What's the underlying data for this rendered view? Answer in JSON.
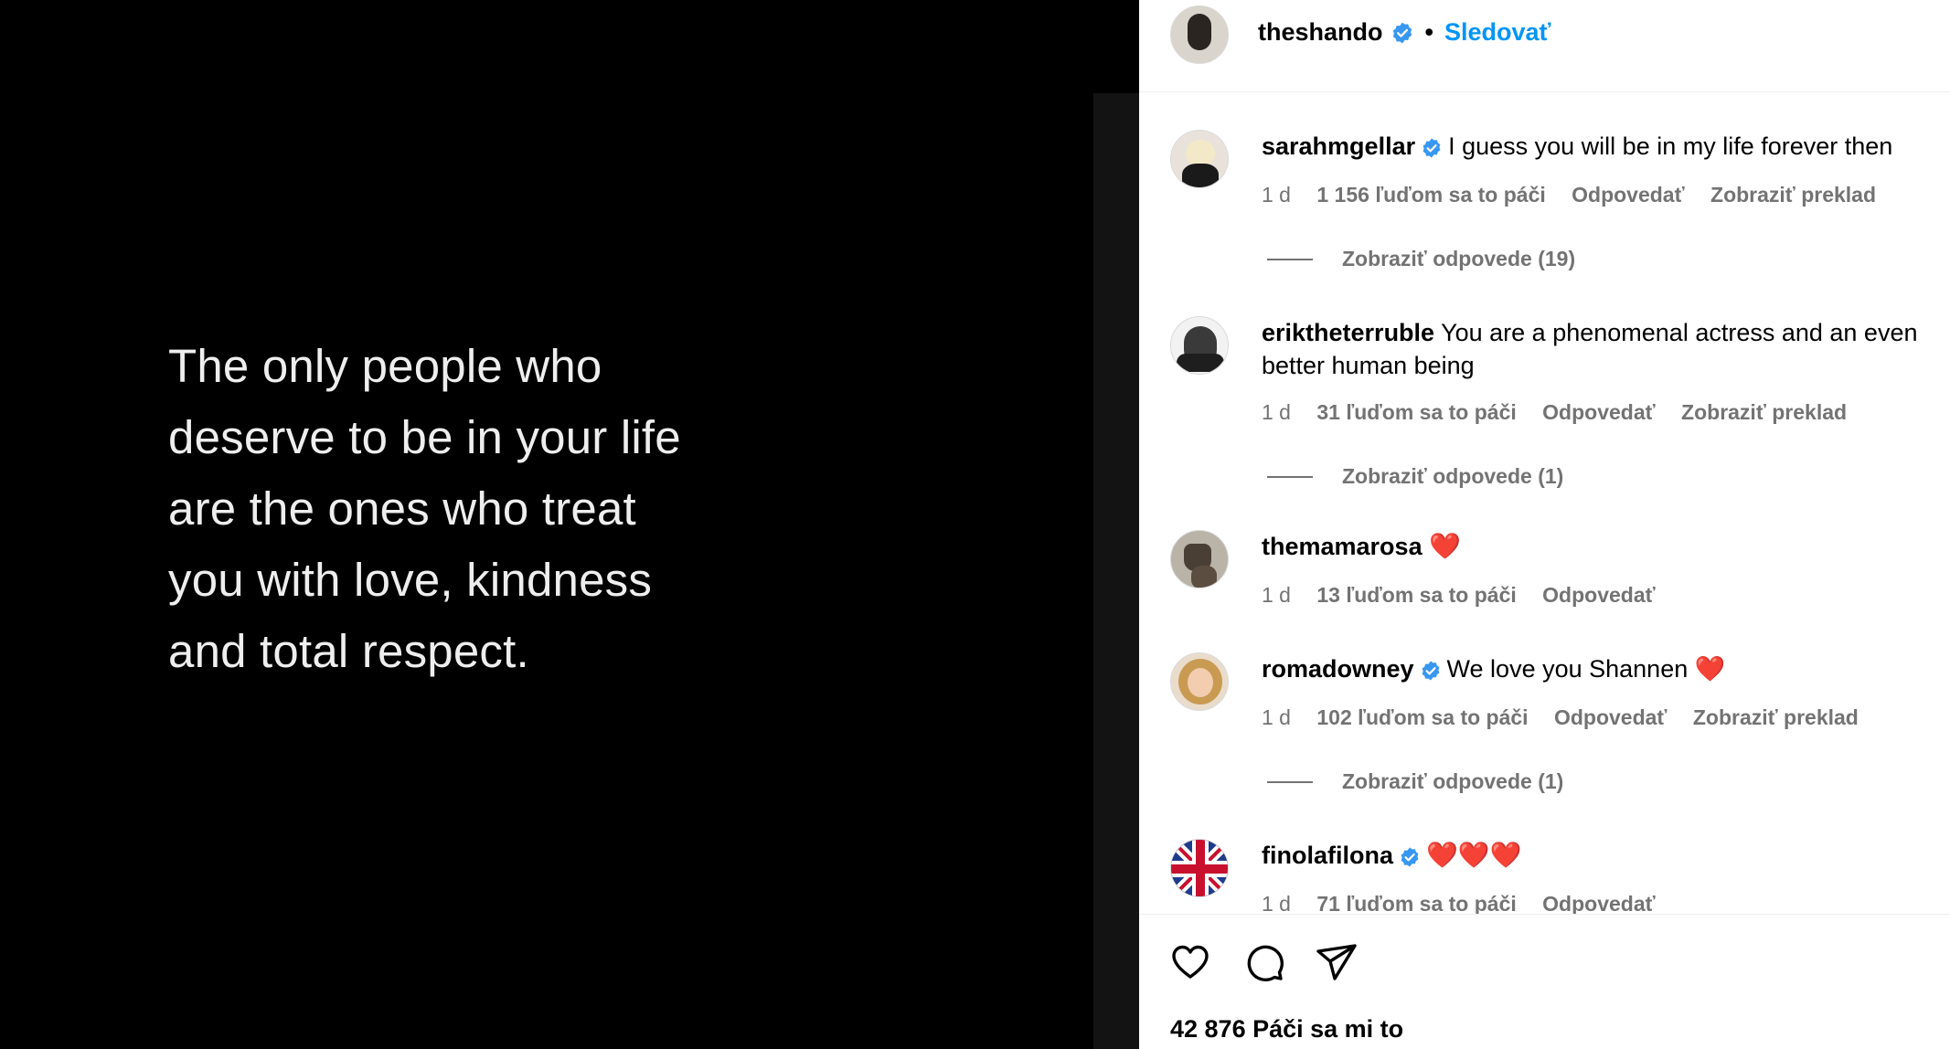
{
  "post": {
    "quote_lines": [
      "The only people who",
      "deserve to be in your life",
      "are the ones who treat",
      "you with love, kindness",
      "and total respect."
    ]
  },
  "header": {
    "username": "theshando",
    "separator": "•",
    "follow_label": "Sledovať"
  },
  "colors": {
    "accent": "#0095f6",
    "verified": "#3897f0",
    "muted": "#737373",
    "heart": "#ed2a2a"
  },
  "comments": [
    {
      "user": "sarahmgellar",
      "verified": true,
      "text": "I guess you will be in my life forever then",
      "time": "1 d",
      "likes": "1 156 ľuďom sa to páči",
      "reply": "Odpovedať",
      "translate": "Zobraziť preklad",
      "replies": "Zobraziť odpovede (19)"
    },
    {
      "user": "eriktheterruble",
      "verified": false,
      "text": "You are a phenomenal actress and an even better human being",
      "time": "1 d",
      "likes": "31 ľuďom sa to páči",
      "reply": "Odpovedať",
      "translate": "Zobraziť preklad",
      "replies": "Zobraziť odpovede (1)"
    },
    {
      "user": "themamarosa",
      "verified": false,
      "text": "❤️",
      "time": "1 d",
      "likes": "13 ľuďom sa to páči",
      "reply": "Odpovedať"
    },
    {
      "user": "romadowney",
      "verified": true,
      "text": "We love you Shannen ❤️",
      "time": "1 d",
      "likes": "102 ľuďom sa to páči",
      "reply": "Odpovedať",
      "translate": "Zobraziť preklad",
      "replies": "Zobraziť odpovede (1)"
    },
    {
      "user": "finolafilona",
      "verified": true,
      "text": "❤️❤️❤️",
      "time": "1 d",
      "likes": "71 ľuďom sa to páči",
      "reply": "Odpovedať"
    }
  ],
  "actions": {
    "like_icon": "heart-outline-icon",
    "comment_icon": "comment-bubble-icon",
    "share_icon": "paper-plane-icon"
  },
  "footer": {
    "likes_count": "42 876 Páči sa mi to"
  }
}
